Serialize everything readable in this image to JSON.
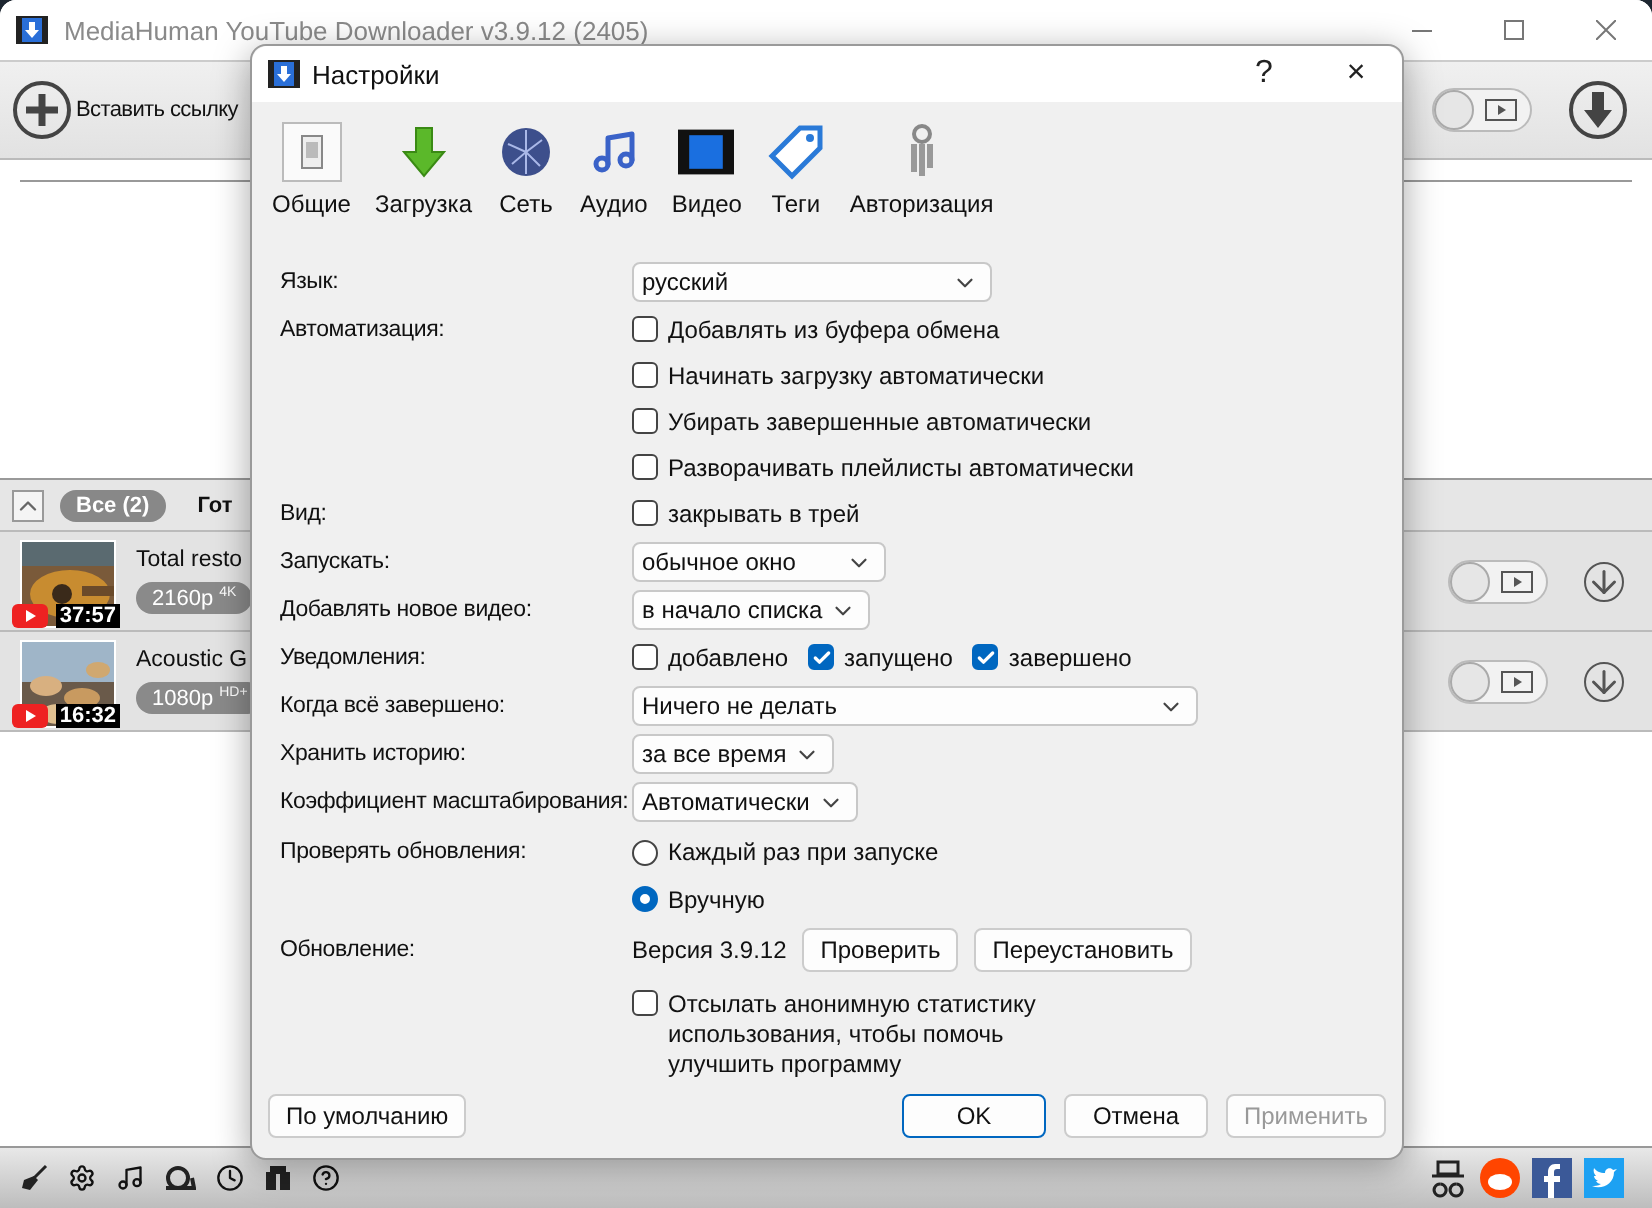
{
  "main_window": {
    "title": "MediaHuman YouTube Downloader v3.9.12 (2405)",
    "toolbar": {
      "paste_label": "Вставить ссылку"
    },
    "filter_tabs": [
      {
        "label": "Все (2)",
        "selected": true
      },
      {
        "label": "Гот",
        "selected": false
      }
    ],
    "downloads": [
      {
        "title": "Total resto",
        "quality": "2160p",
        "badge": "4K",
        "duration": "37:57"
      },
      {
        "title": "Acoustic G",
        "quality": "1080p",
        "badge": "HD+",
        "duration": "16:32"
      }
    ]
  },
  "dialog": {
    "title": "Настройки",
    "help": "?",
    "close": "×",
    "tabs": [
      {
        "label": "Общие",
        "kind": "general",
        "selected": true
      },
      {
        "label": "Загрузка",
        "kind": "download",
        "selected": false
      },
      {
        "label": "Сеть",
        "kind": "network",
        "selected": false
      },
      {
        "label": "Аудио",
        "kind": "audio",
        "selected": false
      },
      {
        "label": "Видео",
        "kind": "video",
        "selected": false
      },
      {
        "label": "Теги",
        "kind": "tags",
        "selected": false
      },
      {
        "label": "Авторизация",
        "kind": "auth",
        "selected": false
      }
    ],
    "rows": [
      {
        "kind": "select",
        "label": "Язык:",
        "value": "русский"
      },
      {
        "kind": "checks",
        "label": "Автоматизация:",
        "options": [
          {
            "label": "Добавлять из буфера обмена",
            "checked": false
          },
          {
            "label": "Начинать загрузку автоматически",
            "checked": false
          },
          {
            "label": "Убирать завершенные автоматически",
            "checked": false
          },
          {
            "label": "Разворачивать плейлисты автоматически",
            "checked": false
          }
        ]
      },
      {
        "kind": "checks",
        "label": "Вид:",
        "options": [
          {
            "label": "закрывать в трей",
            "checked": false
          }
        ]
      },
      {
        "kind": "select",
        "label": "Запускать:",
        "value": "обычное окно"
      },
      {
        "kind": "select",
        "label": "Добавлять новое видео:",
        "value": "в начало списка"
      },
      {
        "kind": "inline_checks",
        "label": "Уведомления:",
        "options": [
          {
            "label": "добавлено",
            "checked": false
          },
          {
            "label": "запущено",
            "checked": true
          },
          {
            "label": "завершено",
            "checked": true
          }
        ]
      },
      {
        "kind": "select",
        "label": "Когда всё завершено:",
        "value": "Ничего не делать"
      },
      {
        "kind": "select",
        "label": "Хранить историю:",
        "value": "за все время"
      },
      {
        "kind": "select",
        "label": "Коэффициент масштабирования:",
        "value": "Автоматически"
      },
      {
        "kind": "radios",
        "label": "Проверять обновления:",
        "options": [
          {
            "label": "Каждый раз при запуске",
            "selected": false
          },
          {
            "label": "Вручную",
            "selected": true
          }
        ]
      },
      {
        "kind": "version",
        "label": "Обновление:",
        "text": "Версия 3.9.12",
        "buttons": [
          "Проверить",
          "Переустановить"
        ]
      },
      {
        "kind": "note_check",
        "text": "Отсылать анонимную статистику использования, чтобы помочь улучшить программу",
        "checked": false
      }
    ],
    "footer": {
      "defaults": "По умолчанию",
      "buttons": [
        {
          "label": "OK",
          "disabled": false
        },
        {
          "label": "Отмена",
          "disabled": false
        },
        {
          "label": "Применить",
          "disabled": true
        }
      ]
    }
  }
}
